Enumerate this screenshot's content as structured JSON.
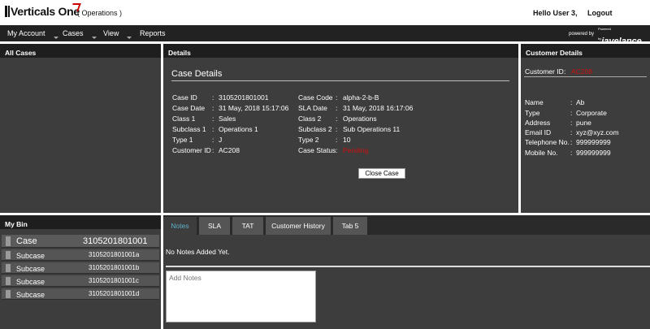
{
  "header": {
    "logo_text": "Verticals One",
    "environment": "( Operations )",
    "greeting": "Hello User 3,",
    "logout": "Logout"
  },
  "nav": {
    "items": [
      "My Account",
      "Cases",
      "View",
      "Reports"
    ],
    "powered_by": "powered by",
    "powered_small": "Powered by",
    "brand": "javelance"
  },
  "panels": {
    "all_cases": "All Cases",
    "details": "Details",
    "customer_details": "Customer Details",
    "my_bin": "My Bin"
  },
  "case_details": {
    "title": "Case Details",
    "left": [
      {
        "label": "Case ID",
        "value": "3105201801001"
      },
      {
        "label": "Case Date",
        "value": "31 May, 2018 15:17:06"
      },
      {
        "label": "Class 1",
        "value": "Sales"
      },
      {
        "label": "Subclass 1",
        "value": "Operations 1"
      },
      {
        "label": "Type 1",
        "value": "J"
      },
      {
        "label": "Customer ID",
        "value": "AC208"
      }
    ],
    "right": [
      {
        "label": "Case Code",
        "value": "alpha-2-b-B"
      },
      {
        "label": "SLA Date",
        "value": "31 May, 2018 16:17:06"
      },
      {
        "label": "Class 2",
        "value": "Operations"
      },
      {
        "label": "Subclass 2",
        "value": "Sub Operations 11"
      },
      {
        "label": "Type 2",
        "value": "10"
      },
      {
        "label": "Case Status",
        "value": "Pending"
      }
    ],
    "close_button": "Close Case",
    "status_color": "#d01010"
  },
  "customer": {
    "id_label": "Customer ID",
    "id_value": "AC208",
    "fields": [
      {
        "label": "Name",
        "value": "Ab"
      },
      {
        "label": "Type",
        "value": "Corporate"
      },
      {
        "label": "Address",
        "value": "pune"
      },
      {
        "label": "Email ID",
        "value": "xyz@xyz.com"
      },
      {
        "label": "Telephone No.",
        "value": "999999999"
      },
      {
        "label": "Mobile No.",
        "value": "999999999"
      }
    ]
  },
  "bin": {
    "case": {
      "label": "Case",
      "number": "3105201801001"
    },
    "subcases": [
      {
        "label": "Subcase",
        "number": "3105201801001a"
      },
      {
        "label": "Subcase",
        "number": "3105201801001b"
      },
      {
        "label": "Subcase",
        "number": "3105201801001c"
      },
      {
        "label": "Subcase",
        "number": "3105201801001d"
      }
    ]
  },
  "tabs": {
    "items": [
      "Notes",
      "SLA",
      "TAT",
      "Customer History",
      "Tab 5"
    ],
    "active": "Notes",
    "notes_empty": "No Notes Added Yet.",
    "notes_placeholder": "Add Notes"
  }
}
